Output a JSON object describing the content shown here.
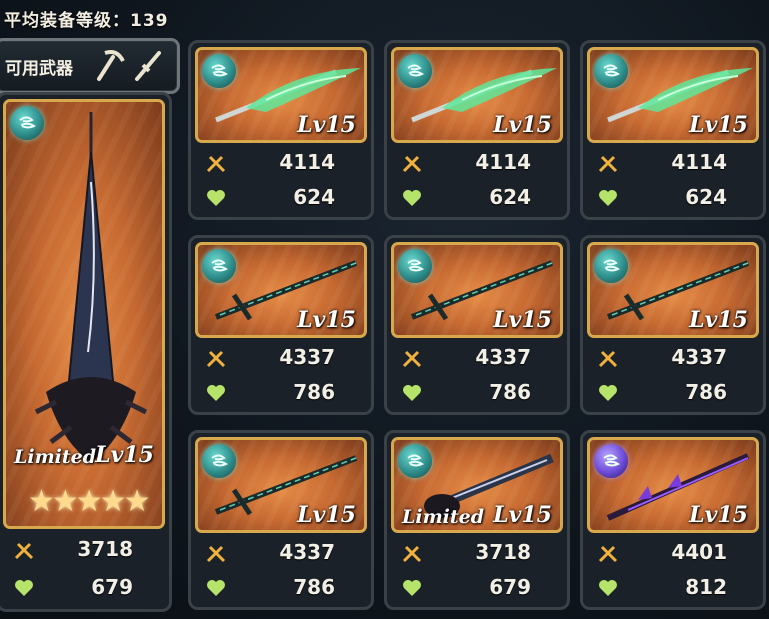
{
  "header": {
    "avg_level_label": "平均装备等级：139"
  },
  "tab": {
    "label": "可用武器",
    "icons": [
      "pickaxe-icon",
      "sword-icon"
    ]
  },
  "featured": {
    "limited": "Limited",
    "level": "Lv15",
    "stars": 5,
    "attack": "3718",
    "hp": "679",
    "element": "wind"
  },
  "grid": [
    {
      "level": "Lv15",
      "attack": "4114",
      "hp": "624",
      "element": "wind",
      "limited": ""
    },
    {
      "level": "Lv15",
      "attack": "4114",
      "hp": "624",
      "element": "wind",
      "limited": ""
    },
    {
      "level": "Lv15",
      "attack": "4114",
      "hp": "624",
      "element": "wind",
      "limited": ""
    },
    {
      "level": "Lv15",
      "attack": "4337",
      "hp": "786",
      "element": "wind",
      "limited": ""
    },
    {
      "level": "Lv15",
      "attack": "4337",
      "hp": "786",
      "element": "wind",
      "limited": ""
    },
    {
      "level": "Lv15",
      "attack": "4337",
      "hp": "786",
      "element": "wind",
      "limited": ""
    },
    {
      "level": "Lv15",
      "attack": "4337",
      "hp": "786",
      "element": "wind",
      "limited": ""
    },
    {
      "level": "Lv15",
      "attack": "3718",
      "hp": "679",
      "element": "wind",
      "limited": "Limited"
    },
    {
      "level": "Lv15",
      "attack": "4401",
      "hp": "812",
      "element": "dark",
      "limited": ""
    }
  ],
  "colors": {
    "frame_gold": "#d7a94c",
    "wind": "#3fb7ae",
    "dark": "#6c4bd6"
  }
}
